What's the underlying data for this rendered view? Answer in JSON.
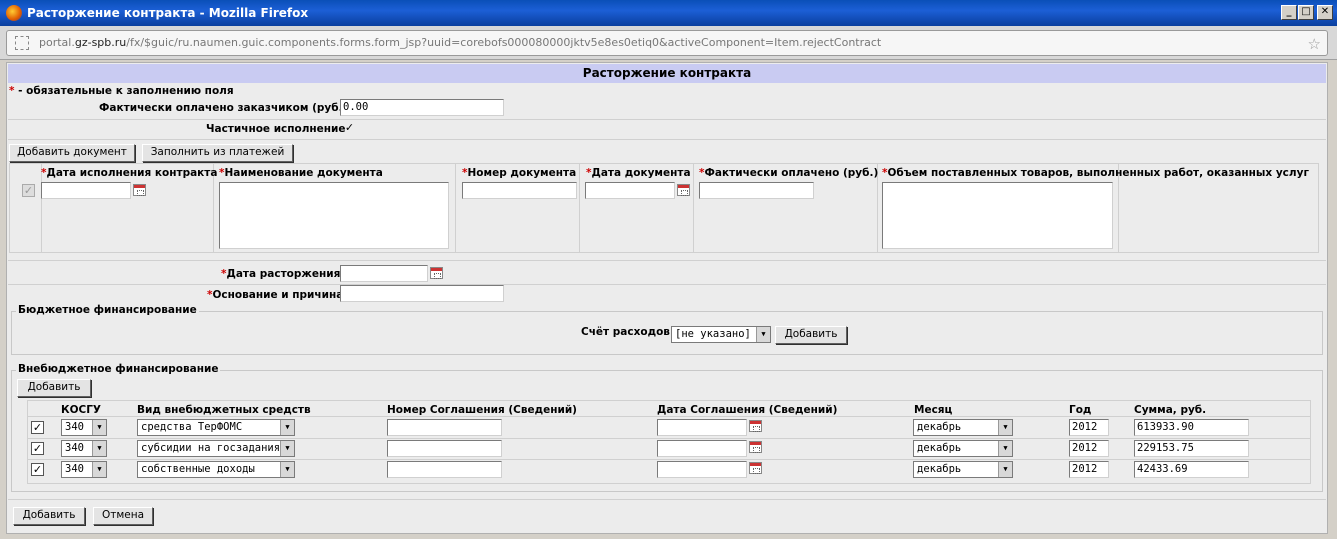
{
  "window": {
    "title": "Расторжение контракта - Mozilla Firefox"
  },
  "address": {
    "prefix": "portal.",
    "host": "gz-spb.ru",
    "path": "/fx/$guic/ru.naumen.guic.components.forms.form_jsp?uuid=corebofs000080000jktv5e8es0etiq0&activeComponent=Item.rejectContract"
  },
  "form": {
    "header": "Расторжение контракта",
    "required_star": "*",
    "required_note": " - обязательные к заполнению поля",
    "paid_label": "Фактически оплачено заказчиком (руб.)",
    "paid_value": "0.00",
    "partial_label": "Частичное исполнение",
    "add_doc_btn": "Добавить документ",
    "fill_payments_btn": "Заполнить из платежей",
    "docs_cols": [
      "Дата исполнения контракта",
      "Наименование документа",
      "Номер документа",
      "Дата документа",
      "Фактически оплачено (руб.)",
      "Объем поставленных товаров, выполненных работ, оказанных услуг"
    ],
    "termination_date_label": "Дата расторжения",
    "reason_label": "Основание и причина",
    "budget_legend": "Бюджетное финансирование",
    "expense_label": "Счёт расходов",
    "expense_value": "[не указано]",
    "budget_add_btn": "Добавить",
    "extra_legend": "Внебюджетное финансирование",
    "extra_add_btn": "Добавить",
    "table_headers": [
      "КОСГУ",
      "Вид внебюджетных средств",
      "Номер Соглашения (Сведений)",
      "Дата Соглашения (Сведений)",
      "Месяц",
      "Год",
      "Сумма, руб."
    ],
    "rows": [
      {
        "kosgu": "340",
        "kind": "средства ТерФОМС",
        "number": "",
        "date": "",
        "month": "декабрь",
        "year": "2012",
        "sum": "613933.90"
      },
      {
        "kosgu": "340",
        "kind": "субсидии на госзадания",
        "number": "",
        "date": "",
        "month": "декабрь",
        "year": "2012",
        "sum": "229153.75"
      },
      {
        "kosgu": "340",
        "kind": "собственные доходы",
        "number": "",
        "date": "",
        "month": "декабрь",
        "year": "2012",
        "sum": "42433.69"
      }
    ],
    "submit_btn": "Добавить",
    "cancel_btn": "Отмена"
  }
}
